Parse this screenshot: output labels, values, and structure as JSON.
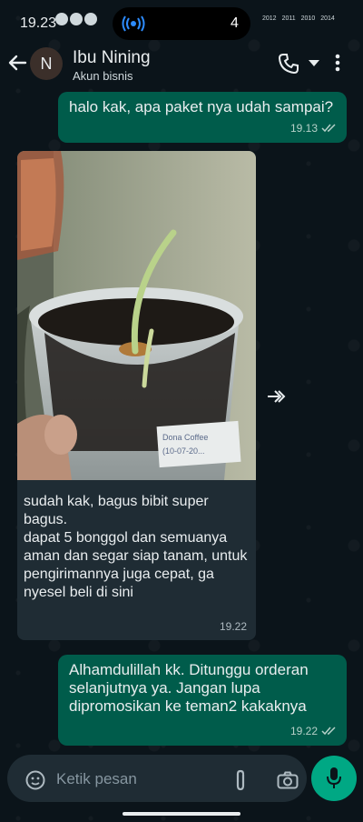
{
  "status_bar": {
    "time": "19.23",
    "notif_count": "4",
    "mini_labels": [
      "2012",
      "2011",
      "2010",
      "2014"
    ]
  },
  "header": {
    "avatar_initial": "N",
    "contact_name": "Ibu Nining",
    "subtitle": "Akun bisnis"
  },
  "messages": [
    {
      "direction": "outgoing",
      "text": "halo kak, apa paket nya udah sampai?",
      "time": "19.13"
    },
    {
      "direction": "incoming",
      "type": "image",
      "caption": "sudah kak, bagus bibit super bagus.\ndapat 5 bonggol dan semuanya aman dan segar siap tanam, untuk pengirimannya juga cepat, ga nyesel beli di sini",
      "time": "19.22",
      "photo_label": "Dona Coffee\n(10-07-20..."
    },
    {
      "direction": "outgoing",
      "text": "Alhamdulillah kk. Ditunggu orderan selanjutnya ya. Jangan lupa dipromosikan ke teman2 kakaknya",
      "time": "19.22"
    }
  ],
  "composer": {
    "placeholder": "Ketik pesan"
  },
  "colors": {
    "background": "#0b141a",
    "outgoing_bubble": "#005c4b",
    "incoming_bubble": "#1f2c34",
    "accent": "#00a884"
  }
}
